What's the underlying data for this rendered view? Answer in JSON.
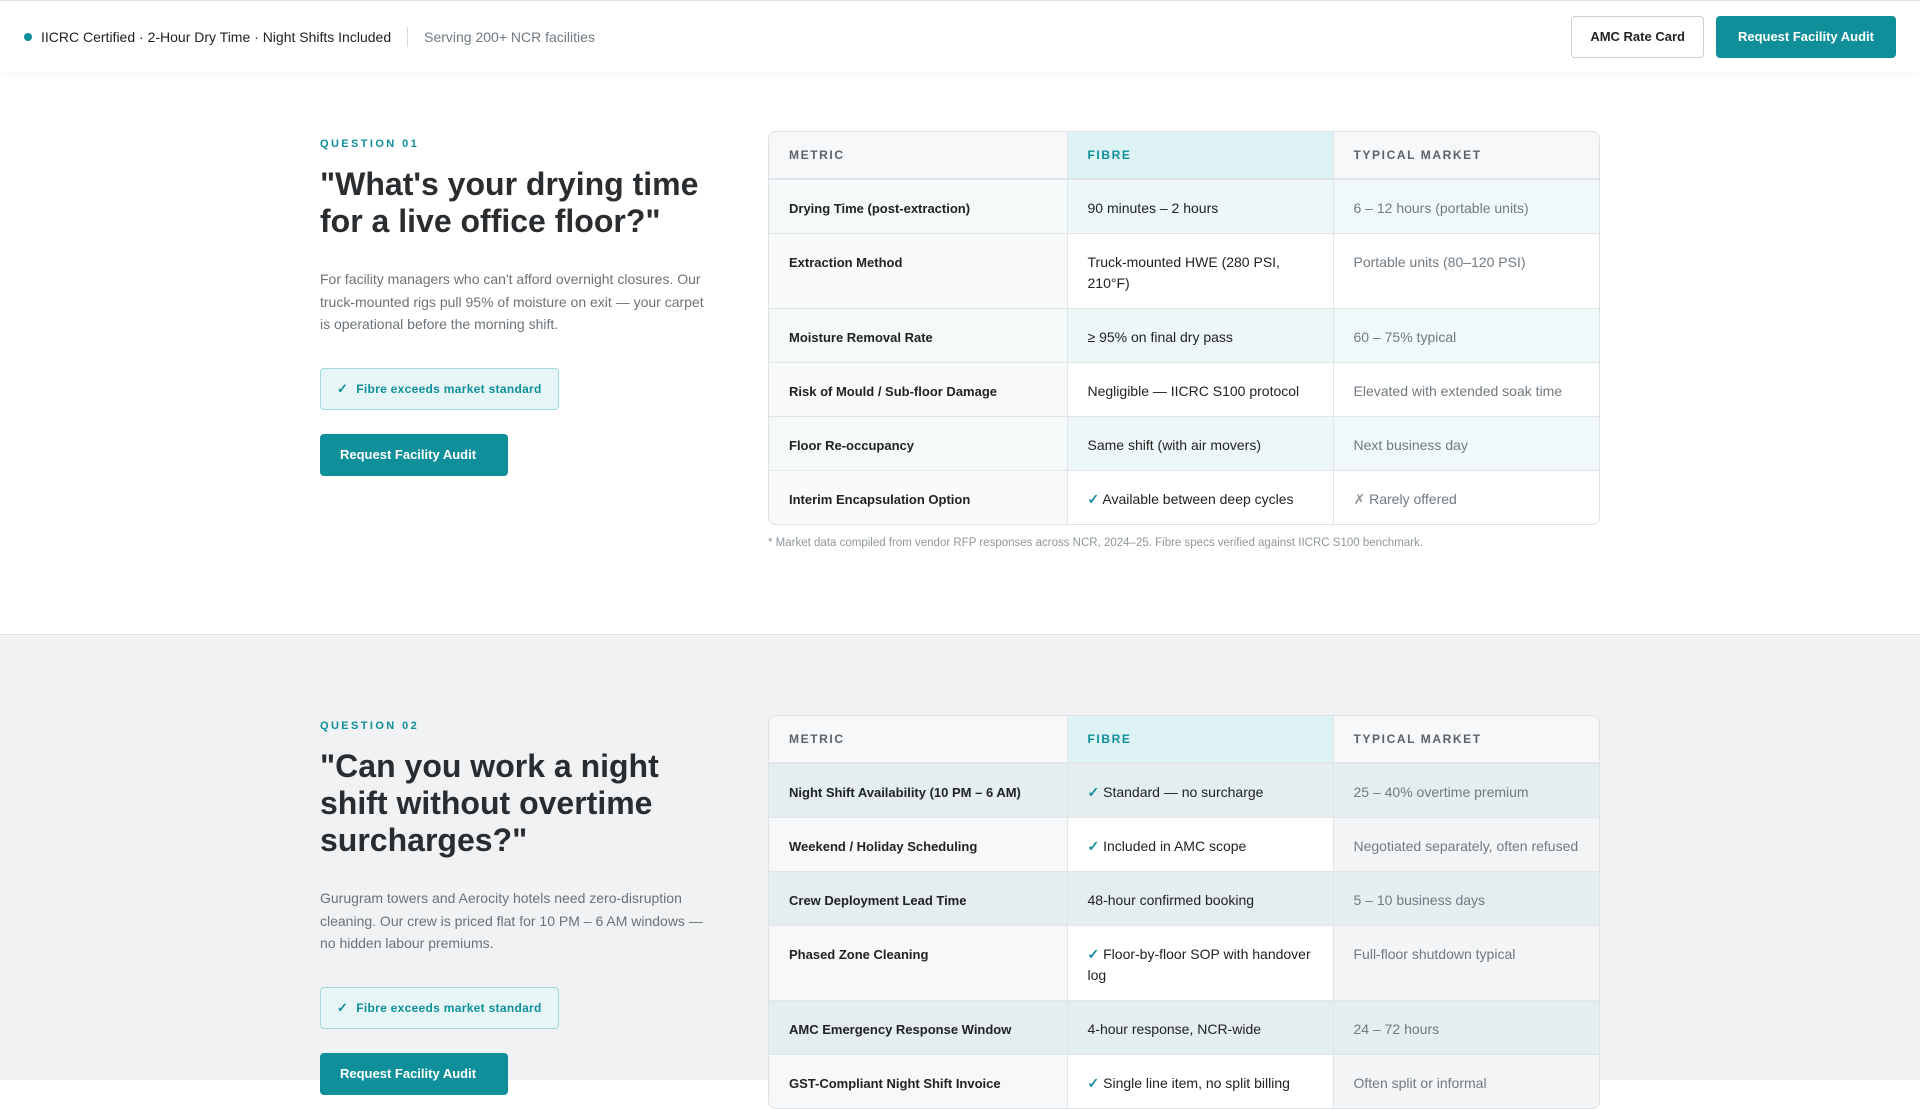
{
  "topbar": {
    "cert_text": "IICRC Certified · 2-Hour Dry Time · Night Shifts Included",
    "serving_text": "Serving 200+ NCR facilities",
    "rate_card_label": "AMC Rate Card",
    "audit_label": "Request Facility Audit"
  },
  "table_headers": {
    "metric": "METRIC",
    "fibre": "FIBRE",
    "market": "TYPICAL MARKET"
  },
  "q1": {
    "eyebrow": "QUESTION 01",
    "question": "\"What's your drying time for a live office floor?\"",
    "description": "For facility managers who can't afford overnight closures. Our truck-mounted rigs pull 95% of moisture on exit — your carpet is operational before the morning shift.",
    "badge": "Fibre exceeds market standard",
    "cta": "Request Facility Audit",
    "rows": [
      {
        "metric": "Drying Time (post-extraction)",
        "fibre": "90 minutes – 2 hours",
        "market": "6 – 12 hours (portable units)"
      },
      {
        "metric": "Extraction Method",
        "fibre": "Truck-mounted HWE (280 PSI, 210°F)",
        "market": "Portable units (80–120 PSI)"
      },
      {
        "metric": "Moisture Removal Rate",
        "fibre": "≥ 95% on final dry pass",
        "market": "60 – 75% typical"
      },
      {
        "metric": "Risk of Mould / Sub-floor Damage",
        "fibre": "Negligible — IICRC S100 protocol",
        "market": "Elevated with extended soak time"
      },
      {
        "metric": "Floor Re-occupancy",
        "fibre": "Same shift (with air movers)",
        "market": "Next business day"
      },
      {
        "metric": "Interim Encapsulation Option",
        "fibre": "Available between deep cycles",
        "market": "Rarely offered"
      }
    ],
    "footnote": "* Market data compiled from vendor RFP responses across NCR, 2024–25. Fibre specs verified against IICRC S100 benchmark."
  },
  "q2": {
    "eyebrow": "QUESTION 02",
    "question": "\"Can you work a night shift without overtime surcharges?\"",
    "description": "Gurugram towers and Aerocity hotels need zero-disruption cleaning. Our crew is priced flat for 10 PM – 6 AM windows — no hidden labour premiums.",
    "badge": "Fibre exceeds market standard",
    "cta": "Request Facility Audit",
    "rows": [
      {
        "metric": "Night Shift Availability (10 PM – 6 AM)",
        "fibre": "Standard — no surcharge",
        "market": "25 – 40% overtime premium"
      },
      {
        "metric": "Weekend / Holiday Scheduling",
        "fibre": "Included in AMC scope",
        "market": "Negotiated separately, often refused"
      },
      {
        "metric": "Crew Deployment Lead Time",
        "fibre": "48-hour confirmed booking",
        "market": "5 – 10 business days"
      },
      {
        "metric": "Phased Zone Cleaning",
        "fibre": "Floor-by-floor SOP with handover log",
        "market": "Full-floor shutdown typical"
      },
      {
        "metric": "AMC Emergency Response Window",
        "fibre": "4-hour response, NCR-wide",
        "market": "24 – 72 hours"
      },
      {
        "metric": "GST-Compliant Night Shift Invoice",
        "fibre": "Single line item, no split billing",
        "market": "Often split or informal"
      }
    ]
  },
  "symbols": {
    "check": "✓",
    "cross": "✗"
  },
  "colors": {
    "accent": "#0e8f9a",
    "section_alt_bg": "#f0f2f3"
  }
}
